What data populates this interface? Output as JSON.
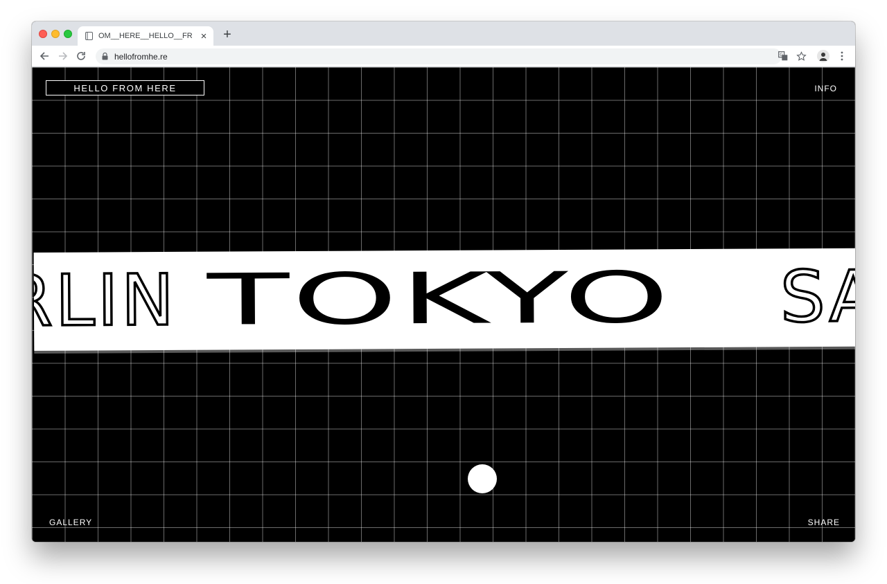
{
  "browser": {
    "tab_title": "OM__HERE__HELLO__FR",
    "url": "hellofromhe.re",
    "new_tab_glyph": "+",
    "close_glyph": "×"
  },
  "site": {
    "logo": "HELLO FROM HERE",
    "info": "INFO",
    "gallery": "GALLERY",
    "share": "SHARE"
  },
  "banner": {
    "cities": [
      "RLIN",
      "TOKYO",
      "SA"
    ]
  },
  "colors": {
    "page_background": "#000000",
    "grid_line": "#6b6b6b",
    "banner_background": "#ffffff",
    "tab_strip": "#dee1e6"
  },
  "icons": {
    "back": "back-arrow-icon",
    "forward": "forward-arrow-icon",
    "reload": "reload-icon",
    "lock": "lock-icon",
    "translate": "translate-icon",
    "bookmark": "star-icon",
    "profile": "avatar-icon",
    "menu": "kebab-menu-icon"
  }
}
